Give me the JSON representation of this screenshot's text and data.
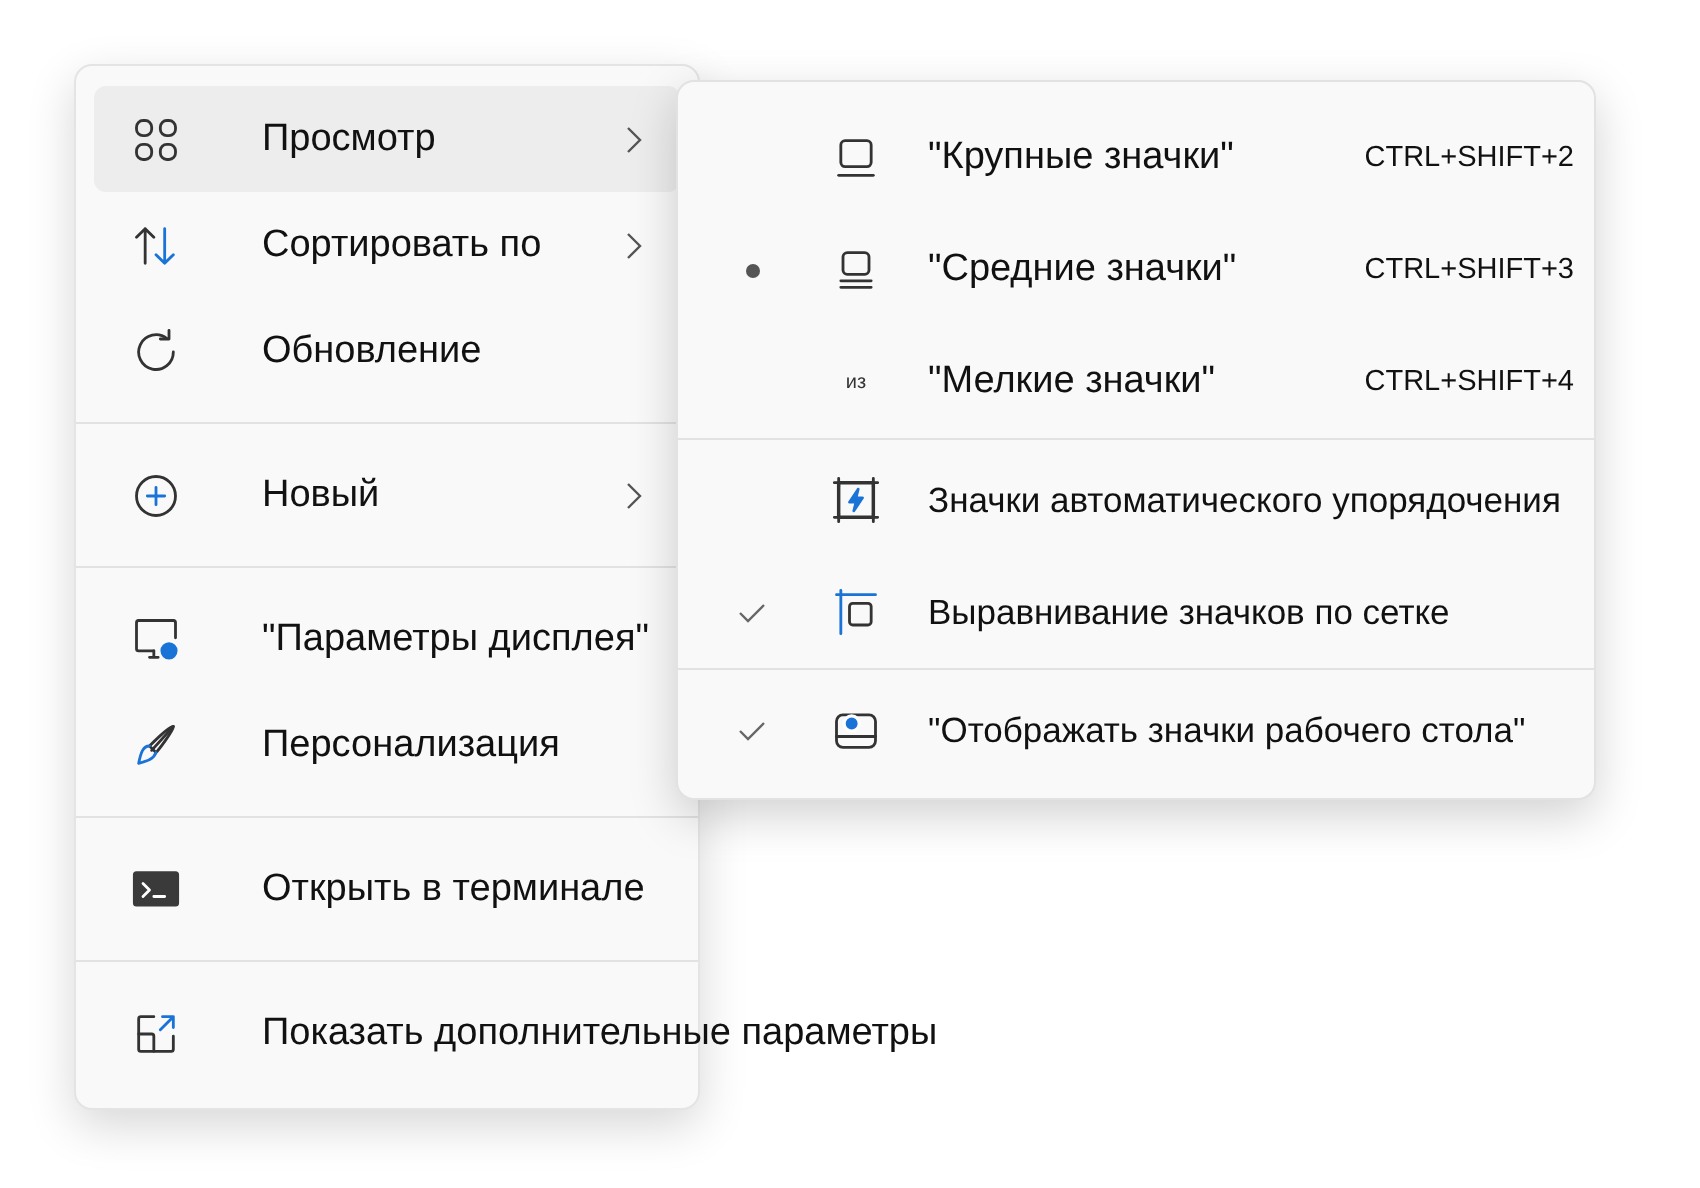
{
  "context_menu": {
    "sections": [
      [
        {
          "label": "Просмотр",
          "has_submenu": true,
          "selected": true
        },
        {
          "label": "Сортировать по",
          "has_submenu": true,
          "selected": false
        },
        {
          "label": "Обновление",
          "has_submenu": false,
          "selected": false
        }
      ],
      [
        {
          "label": "Новый",
          "has_submenu": true,
          "selected": false
        }
      ],
      [
        {
          "label": "\"Параметры дисплея\"",
          "has_submenu": false,
          "selected": false
        },
        {
          "label": "Персонализация",
          "has_submenu": false,
          "selected": false
        }
      ],
      [
        {
          "label": "Открыть в терминале",
          "has_submenu": false,
          "selected": false
        }
      ],
      [
        {
          "label": "Показать дополнительные параметры",
          "has_submenu": false,
          "selected": false
        }
      ]
    ]
  },
  "submenu": {
    "sections": [
      [
        {
          "kind": "radio",
          "label": "\"Крупные значки\"",
          "shortcut": "CTRL+SHIFT+2",
          "selected": false
        },
        {
          "kind": "radio",
          "label": "\"Средние значки\"",
          "shortcut": "CTRL+SHIFT+3",
          "selected": true
        },
        {
          "kind": "radio",
          "label": "\"Мелкие значки\"",
          "shortcut": "CTRL+SHIFT+4",
          "icon_text": "из",
          "selected": false
        }
      ],
      [
        {
          "kind": "check",
          "label": "Значки автоматического упорядочения",
          "checked": false
        },
        {
          "kind": "check",
          "label": "Выравнивание значков по сетке",
          "checked": true
        }
      ],
      [
        {
          "kind": "check",
          "label": "\"Отображать значки рабочего стола\"",
          "checked": true
        }
      ]
    ]
  }
}
